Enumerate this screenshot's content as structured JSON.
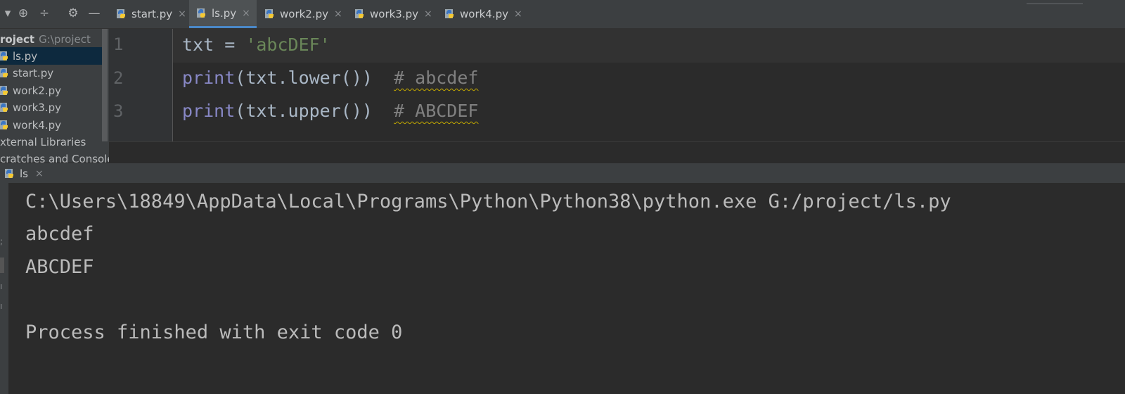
{
  "tabs": [
    {
      "label": "start.py",
      "active": false
    },
    {
      "label": "ls.py",
      "active": true
    },
    {
      "label": "work2.py",
      "active": false
    },
    {
      "label": "work3.py",
      "active": false
    },
    {
      "label": "work4.py",
      "active": false
    }
  ],
  "project": {
    "root_label": "roject",
    "root_path": "G:\\project",
    "files": [
      "ls.py",
      "start.py",
      "work2.py",
      "work3.py",
      "work4.py"
    ],
    "external_libraries": "xternal Libraries",
    "scratches": "cratches and Consoles"
  },
  "editor": {
    "line_numbers": [
      "1",
      "2",
      "3"
    ],
    "lines": [
      {
        "a": "txt = ",
        "b": "'abcDEF'"
      },
      {
        "kw": "print",
        "code": "(txt.lower())  ",
        "comment": "# abcdef"
      },
      {
        "kw": "print",
        "code": "(txt.upper())  ",
        "comment": "# ABCDEF"
      }
    ]
  },
  "run": {
    "tab_label": "ls",
    "output": [
      "C:\\Users\\18849\\AppData\\Local\\Programs\\Python\\Python38\\python.exe G:/project/ls.py",
      "abcdef",
      "ABCDEF",
      "",
      "Process finished with exit code 0"
    ]
  },
  "icons": {
    "tab_close": "×",
    "python_file": "python-file-icon",
    "gear": "⚙",
    "minimize": "—",
    "target": "⊕"
  },
  "colors": {
    "accent_tab_underline": "#4a88c7",
    "keyword": "#8888c6",
    "string": "#6a8759",
    "comment": "#808080"
  }
}
